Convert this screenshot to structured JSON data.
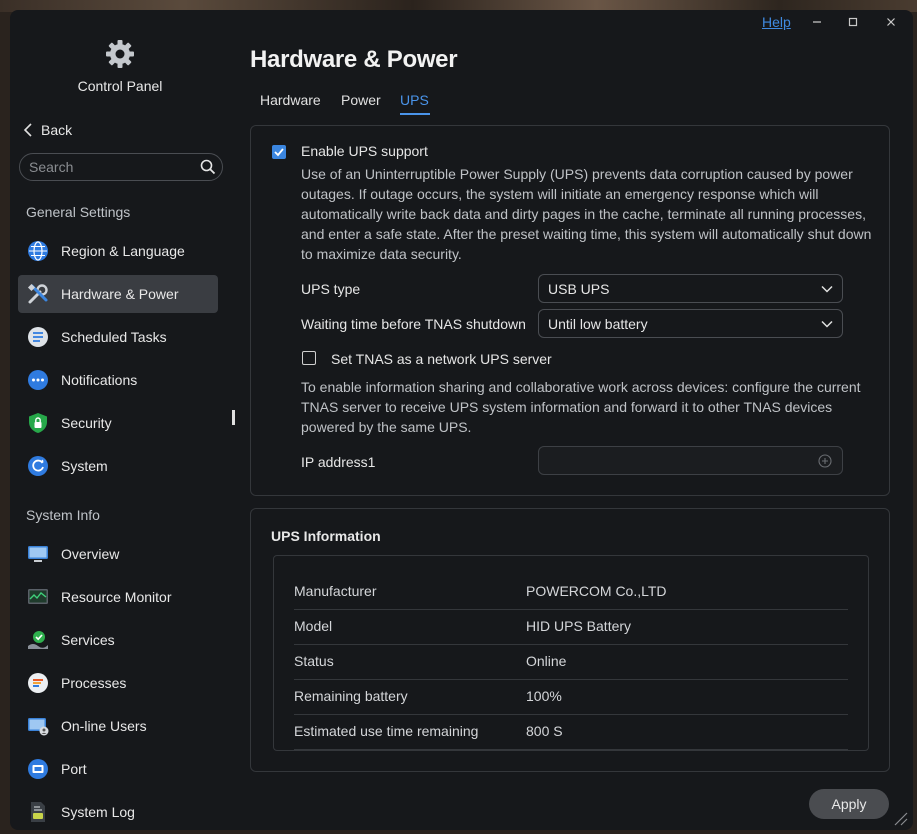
{
  "window": {
    "help_label": "Help",
    "minimize_label": "–",
    "maximize_label": "□",
    "close_label": "✕"
  },
  "sidebar": {
    "app_title": "Control Panel",
    "app_icon": "gear-icon",
    "back_label": "Back",
    "search_placeholder": "Search",
    "sections": [
      {
        "title": "General Settings",
        "items": [
          {
            "label": "Region & Language",
            "icon": "globe-icon"
          },
          {
            "label": "Hardware & Power",
            "icon": "tools-icon",
            "active": true
          },
          {
            "label": "Scheduled Tasks",
            "icon": "task-list-icon"
          },
          {
            "label": "Notifications",
            "icon": "chat-bubble-icon"
          },
          {
            "label": "Security",
            "icon": "shield-lock-icon"
          },
          {
            "label": "System",
            "icon": "system-refresh-icon"
          }
        ]
      },
      {
        "title": "System Info",
        "items": [
          {
            "label": "Overview",
            "icon": "monitor-icon"
          },
          {
            "label": "Resource Monitor",
            "icon": "resource-monitor-icon"
          },
          {
            "label": "Services",
            "icon": "services-check-icon"
          },
          {
            "label": "Processes",
            "icon": "processes-icon"
          },
          {
            "label": "On-line Users",
            "icon": "online-users-icon"
          },
          {
            "label": "Port",
            "icon": "port-icon"
          },
          {
            "label": "System Log",
            "icon": "system-log-icon"
          }
        ]
      }
    ]
  },
  "main": {
    "title": "Hardware & Power",
    "tabs": [
      {
        "label": "Hardware"
      },
      {
        "label": "Power"
      },
      {
        "label": "UPS",
        "active": true
      }
    ],
    "ups": {
      "enable_label": "Enable UPS support",
      "enable_checked": true,
      "description": "Use of an Uninterruptible Power Supply (UPS) prevents data corruption caused by power outages. If outage occurs, the system will initiate an emergency response which will automatically write back data and dirty pages in the cache, terminate all running processes, and enter a safe state. After the preset waiting time, this system will automatically shut down to maximize data security.",
      "ups_type_label": "UPS type",
      "ups_type_value": "USB UPS",
      "wait_label": "Waiting time before TNAS shutdown",
      "wait_value": "Until low battery",
      "network_server_label": "Set TNAS as a network UPS server",
      "network_server_checked": false,
      "network_description": "To enable information sharing and collaborative work across devices: configure the current TNAS server to receive UPS system information and forward it to other TNAS devices powered by the same UPS.",
      "ip_label": "IP address1",
      "ip_value": ""
    },
    "info": {
      "title": "UPS Information",
      "rows": [
        {
          "key": "Manufacturer",
          "value": "POWERCOM Co.,LTD"
        },
        {
          "key": "Model",
          "value": "HID UPS Battery"
        },
        {
          "key": "Status",
          "value": "Online"
        },
        {
          "key": "Remaining battery",
          "value": "100%"
        },
        {
          "key": "Estimated use time remaining",
          "value": "800 S"
        }
      ]
    },
    "apply_label": "Apply"
  },
  "colors": {
    "accent": "#3b86e0",
    "window_bg": "#16181b",
    "active_nav_bg": "#3a3d42"
  }
}
